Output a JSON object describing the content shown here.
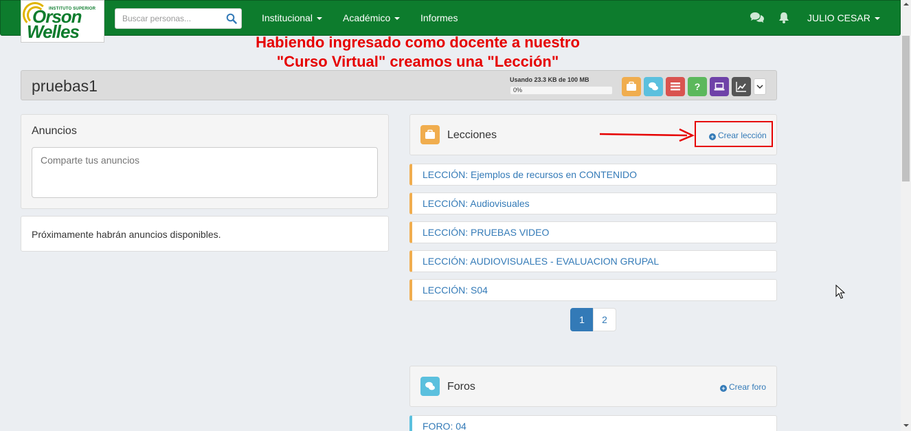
{
  "navbar": {
    "logo": {
      "small_text": "INSTITUTO SUPERIOR",
      "line1": "Orson",
      "line2": "Welles"
    },
    "search_placeholder": "Buscar personas...",
    "menu": [
      {
        "label": "Institucional"
      },
      {
        "label": "Académico"
      },
      {
        "label": "Informes"
      }
    ],
    "user": "JULIO CESAR",
    "chat_icon": "comments-icon",
    "bell_icon": "bell-icon",
    "color": "#0d7c2d"
  },
  "annotation": {
    "line1": "Habiendo ingresado como docente a nuestro",
    "line2": "\"Curso Virtual\" creamos una \"Lección\"",
    "color": "#e60000"
  },
  "course": {
    "title": "pruebas1",
    "usage_text": "Usando 23.3 KB de 100 MB",
    "progress_text": "0%",
    "progress_value": 0,
    "tools": [
      {
        "icon": "briefcase-icon",
        "color": "#f0ad4e"
      },
      {
        "icon": "comments-icon",
        "color": "#5bc0de"
      },
      {
        "icon": "list-icon",
        "color": "#d9534f"
      },
      {
        "icon": "question-icon",
        "color": "#5cb85c"
      },
      {
        "icon": "laptop-icon",
        "color": "#6f42a8"
      },
      {
        "icon": "chart-icon",
        "color": "#555555"
      }
    ]
  },
  "anuncios": {
    "title": "Anuncios",
    "placeholder": "Comparte tus anuncios",
    "empty_text": "Próximamente habrán anuncios disponibles."
  },
  "lecciones": {
    "title": "Lecciones",
    "create_label": "Crear lección",
    "items": [
      {
        "label": "LECCIÓN: Ejemplos de recursos en CONTENIDO"
      },
      {
        "label": "LECCIÓN: Audiovisuales"
      },
      {
        "label": "LECCIÓN: PRUEBAS VIDEO"
      },
      {
        "label": "LECCIÓN: AUDIOVISUALES - EVALUACION GRUPAL"
      },
      {
        "label": "LECCIÓN: S04"
      }
    ],
    "pagination": {
      "pages": [
        "1",
        "2"
      ],
      "current": "1"
    }
  },
  "foros": {
    "title": "Foros",
    "create_label": "Crear foro",
    "items": [
      {
        "label": "FORO: 04"
      }
    ]
  }
}
